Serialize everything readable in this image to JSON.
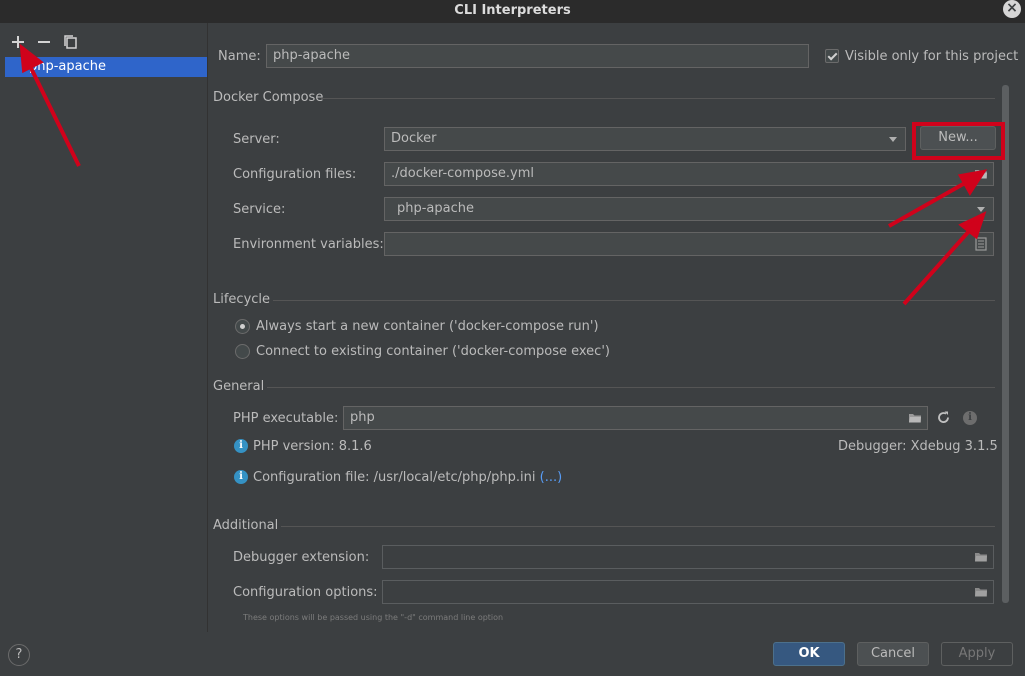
{
  "window": {
    "title": "CLI Interpreters"
  },
  "left": {
    "items": [
      {
        "label": "php-apache"
      }
    ]
  },
  "form": {
    "name_label": "Name:",
    "name_value": "php-apache",
    "visible_only_label": "Visible only for this project",
    "docker_compose": {
      "section": "Docker Compose",
      "server_label": "Server:",
      "server_value": "Docker",
      "new_button": "New...",
      "config_files_label": "Configuration files:",
      "config_files_value": "./docker-compose.yml",
      "service_label": "Service:",
      "service_value": "php-apache",
      "env_label": "Environment variables:",
      "env_value": ""
    },
    "lifecycle": {
      "section": "Lifecycle",
      "option1": "Always start a new container ('docker-compose run')",
      "option2": "Connect to existing container ('docker-compose exec')",
      "selected": "option1"
    },
    "general": {
      "section": "General",
      "php_exec_label": "PHP executable:",
      "php_exec_value": "php",
      "php_version": "PHP version: 8.1.6",
      "debugger": "Debugger: Xdebug 3.1.5",
      "config_file_prefix": "Configuration file: /usr/local/etc/php/php.ini",
      "config_file_link": "(...)"
    },
    "additional": {
      "section": "Additional",
      "debugger_ext_label": "Debugger extension:",
      "config_options_label": "Configuration options:",
      "hint": "These options will be passed using the \"-d\" command line option"
    }
  },
  "footer": {
    "ok": "OK",
    "cancel": "Cancel",
    "apply": "Apply",
    "help": "?"
  },
  "colors": {
    "accent": "#2f65ca",
    "annotation": "#d0021b"
  },
  "icons": [
    "add-icon",
    "remove-icon",
    "copy-icon",
    "folder-icon",
    "refresh-icon",
    "info-icon",
    "document-icon",
    "close-icon",
    "help-icon"
  ]
}
